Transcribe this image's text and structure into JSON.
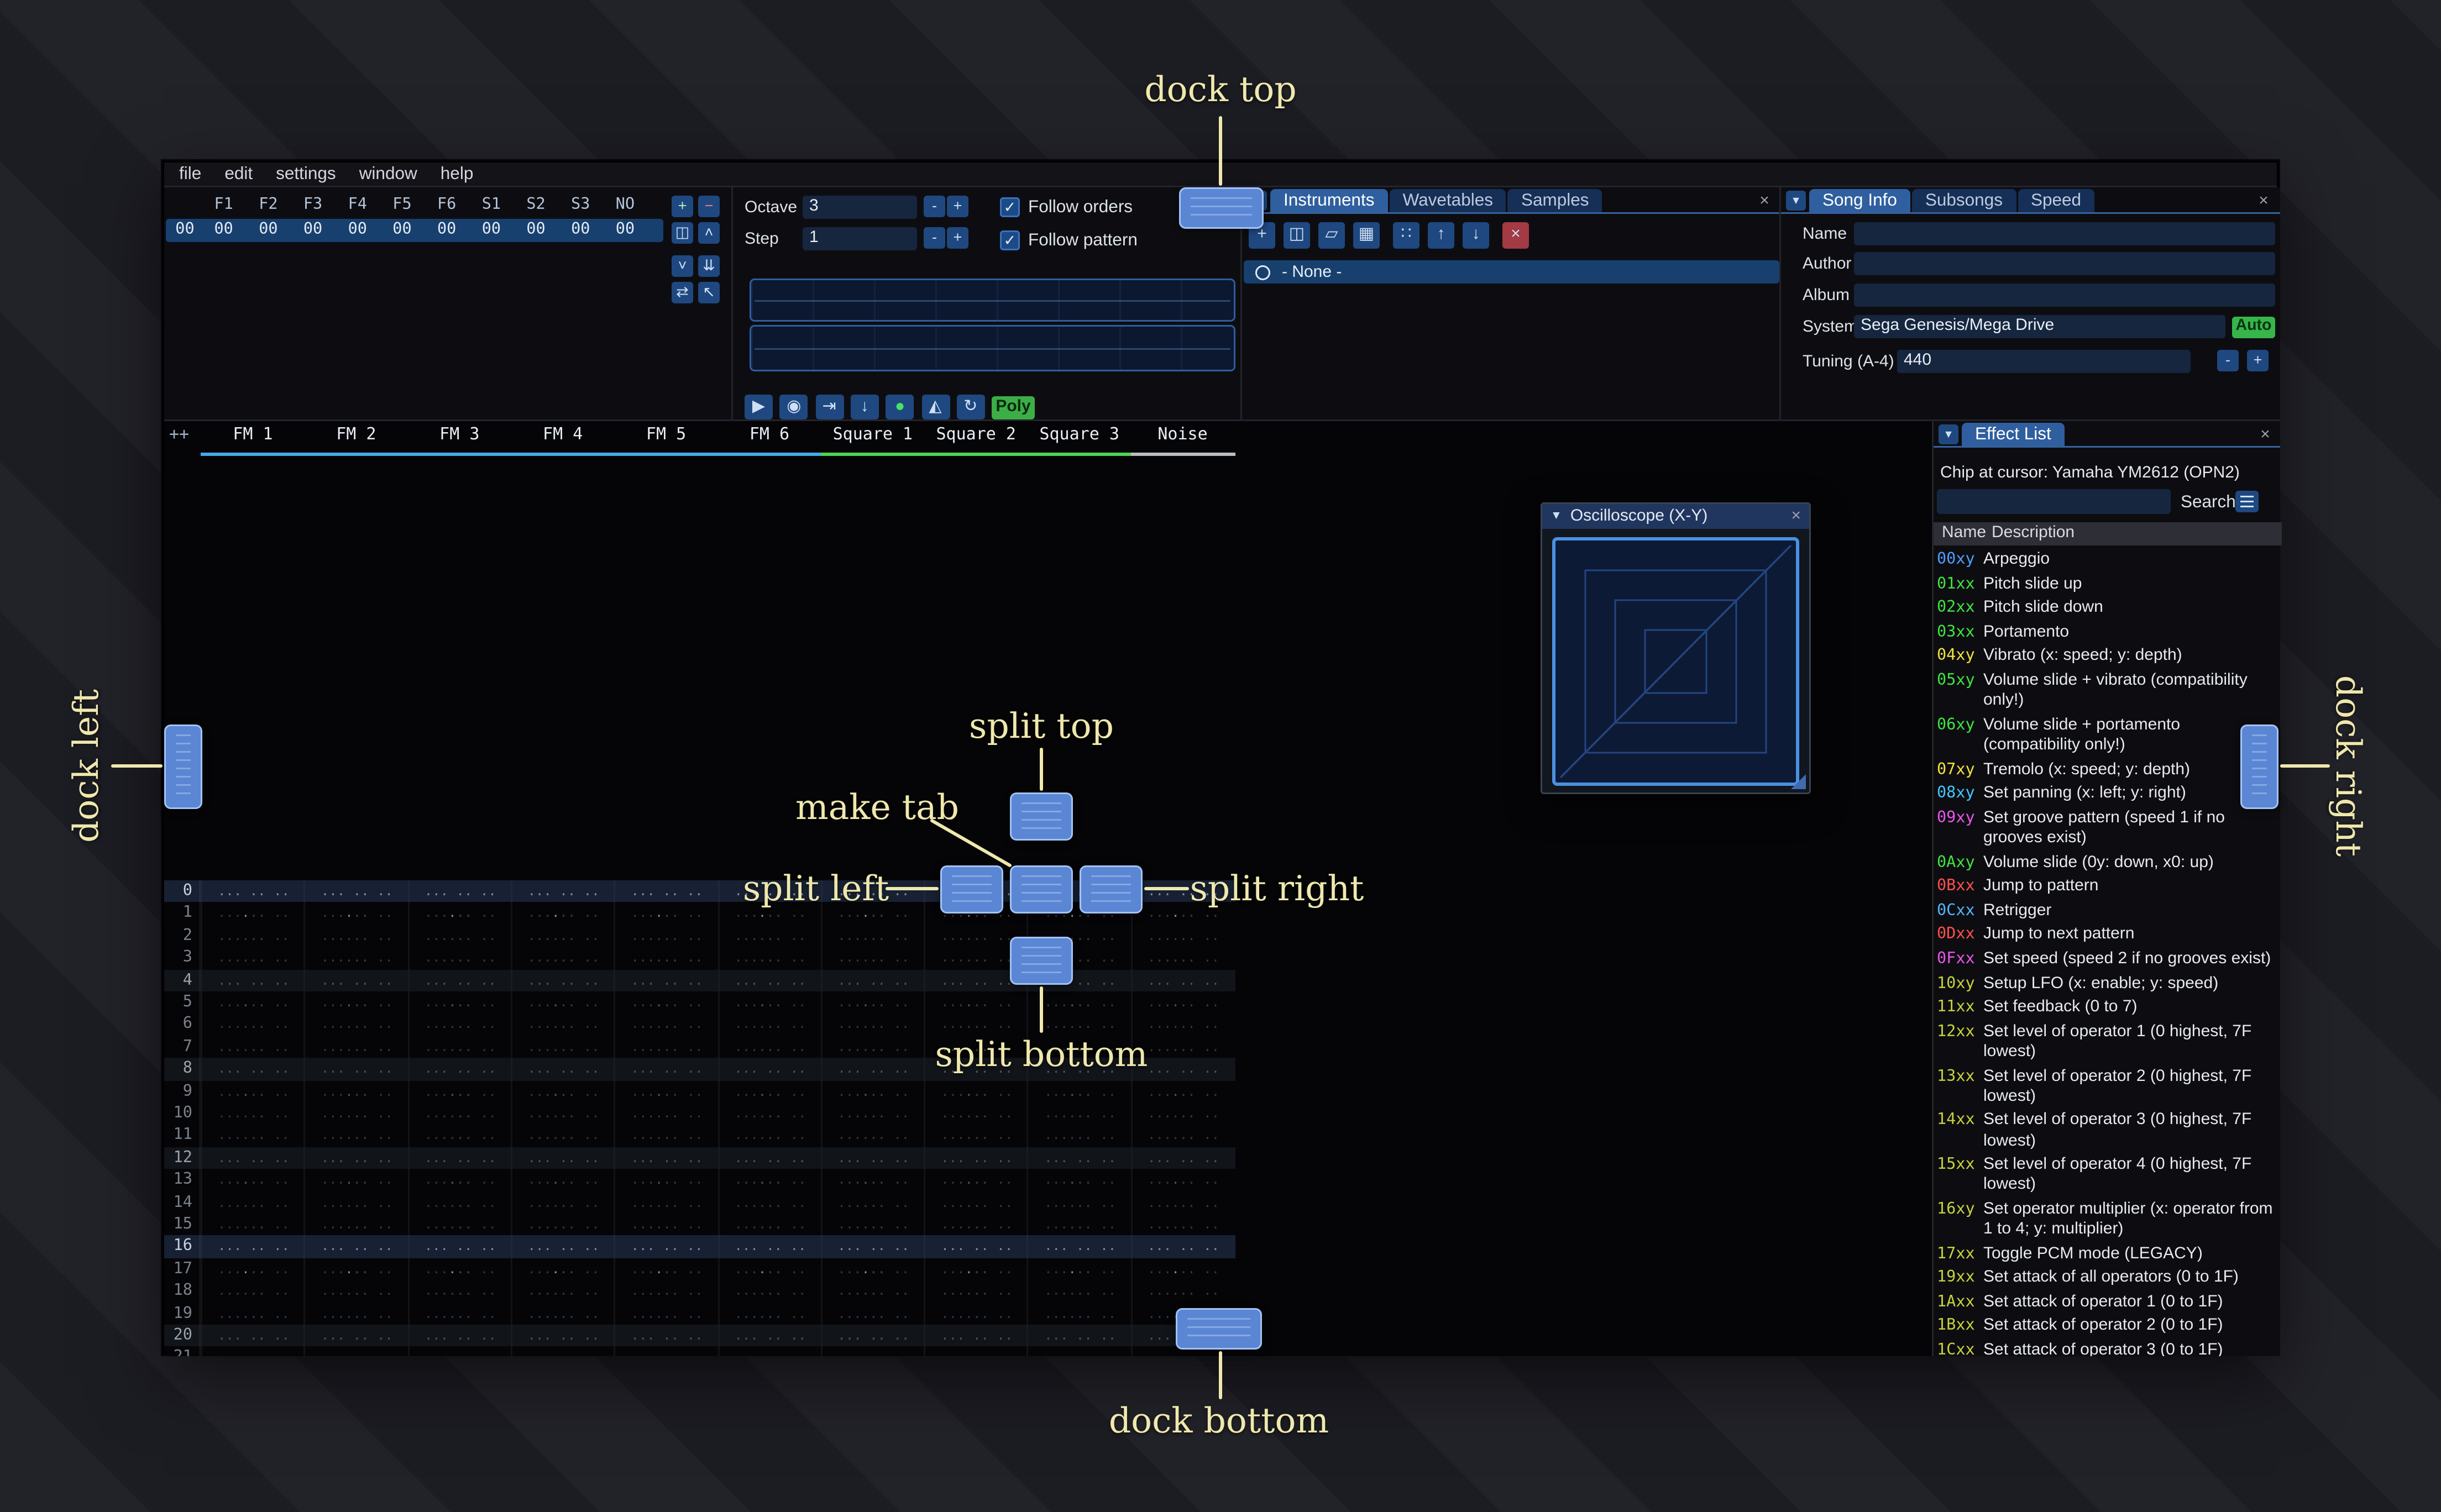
{
  "ui": {
    "minus": "-",
    "plus": "+",
    "check": "✓",
    "collapse": "▼",
    "close": "×"
  },
  "colors": {
    "accent": "#4296fa",
    "selection": "#17406f",
    "dock_overlay": "#5a86d4",
    "annotation": "#efe8ad"
  },
  "menu": {
    "items": [
      "file",
      "edit",
      "settings",
      "window",
      "help"
    ]
  },
  "orders": {
    "channels": [
      "F1",
      "F2",
      "F3",
      "F4",
      "F5",
      "F6",
      "S1",
      "S2",
      "S3",
      "NO"
    ],
    "row": {
      "index": "00",
      "values": [
        "00",
        "00",
        "00",
        "00",
        "00",
        "00",
        "00",
        "00",
        "00",
        "00"
      ]
    },
    "buttons": [
      {
        "name": "add",
        "glyph": "+",
        "color": "#b9f0c0"
      },
      {
        "name": "remove",
        "glyph": "−",
        "color": "#ff7a7a"
      },
      {
        "name": "duplicate",
        "glyph": "◫"
      },
      {
        "name": "move-up",
        "glyph": "˄"
      },
      {
        "name": "move-down",
        "glyph": "˅"
      },
      {
        "name": "duplicate-to-end",
        "glyph": "⇊"
      },
      {
        "name": "change-all",
        "glyph": "⇄"
      },
      {
        "name": "edit-mode",
        "glyph": "↖"
      }
    ]
  },
  "play_controls": {
    "octave_label": "Octave",
    "octave_value": "3",
    "step_label": "Step",
    "step_value": "1",
    "follow_orders": "Follow orders",
    "follow_pattern": "Follow pattern",
    "poly_label": "Poly",
    "transport": [
      {
        "name": "play",
        "glyph": "▶"
      },
      {
        "name": "play-pattern",
        "glyph": "◉"
      },
      {
        "name": "play-from-cursor",
        "glyph": "⇥"
      },
      {
        "name": "step-one-row",
        "glyph": "↓"
      },
      {
        "name": "edit-record",
        "glyph": "●",
        "color": "#42e663"
      },
      {
        "name": "metronome",
        "glyph": "◭"
      },
      {
        "name": "repeat-pattern",
        "glyph": "↻"
      }
    ]
  },
  "instruments": {
    "tabs": [
      "Instruments",
      "Wavetables",
      "Samples"
    ],
    "active_tab": "Instruments",
    "toolbar": [
      {
        "name": "add-instrument",
        "glyph": "+"
      },
      {
        "name": "duplicate-instrument",
        "glyph": "◫"
      },
      {
        "name": "open-instrument",
        "glyph": "▱"
      },
      {
        "name": "save-instrument",
        "glyph": "▦"
      },
      {
        "name": "instrument-folders",
        "glyph": "∷"
      },
      {
        "name": "move-instrument-up",
        "glyph": "↑"
      },
      {
        "name": "move-instrument-down",
        "glyph": "↓"
      },
      {
        "name": "delete-instrument",
        "glyph": "×",
        "bg": "#a33a44"
      }
    ],
    "list": [
      {
        "label": "- None -",
        "selected": true
      }
    ]
  },
  "song_info": {
    "tabs": [
      "Song Info",
      "Subsongs",
      "Speed"
    ],
    "active_tab": "Song Info",
    "name_label": "Name",
    "name_value": "",
    "author_label": "Author",
    "author_value": "",
    "album_label": "Album",
    "album_value": "",
    "system_label": "System",
    "system_value": "Sega Genesis/Mega Drive",
    "auto_label": "Auto",
    "tuning_label": "Tuning (A-4)",
    "tuning_value": "440"
  },
  "pattern": {
    "corner_label": "++",
    "channels": [
      {
        "name": "FM 1",
        "color": "#45aae8"
      },
      {
        "name": "FM 2",
        "color": "#45aae8"
      },
      {
        "name": "FM 3",
        "color": "#45aae8"
      },
      {
        "name": "FM 4",
        "color": "#45aae8"
      },
      {
        "name": "FM 5",
        "color": "#45aae8"
      },
      {
        "name": "FM 6",
        "color": "#45aae8"
      },
      {
        "name": "Square 1",
        "color": "#4fd44f"
      },
      {
        "name": "Square 2",
        "color": "#4fd44f"
      },
      {
        "name": "Square 3",
        "color": "#4fd44f"
      },
      {
        "name": "Noise",
        "color": "#b8bdc4"
      }
    ],
    "rows": {
      "start": 0,
      "count": 22
    },
    "empty_cell": "... .. .. ..."
  },
  "oscilloscope": {
    "title": "Oscilloscope (X-Y)"
  },
  "effect_list": {
    "tab": "Effect List",
    "chip_line": "Chip at cursor: Yamaha YM2612 (OPN2)",
    "search_label": "Search",
    "search_value": "",
    "columns": [
      "Name",
      "Description"
    ],
    "effects": [
      {
        "name": "00xy",
        "color": "#4d9fff",
        "desc": "Arpeggio"
      },
      {
        "name": "01xx",
        "color": "#3fe43f",
        "desc": "Pitch slide up"
      },
      {
        "name": "02xx",
        "color": "#3fe43f",
        "desc": "Pitch slide down"
      },
      {
        "name": "03xx",
        "color": "#3fe43f",
        "desc": "Portamento"
      },
      {
        "name": "04xy",
        "color": "#f2e33c",
        "desc": "Vibrato (x: speed; y: depth)"
      },
      {
        "name": "05xy",
        "color": "#3fe43f",
        "desc": "Volume slide + vibrato (compatibility only!)"
      },
      {
        "name": "06xy",
        "color": "#3fe43f",
        "desc": "Volume slide + portamento (compatibility only!)"
      },
      {
        "name": "07xy",
        "color": "#f2e33c",
        "desc": "Tremolo (x: speed; y: depth)"
      },
      {
        "name": "08xy",
        "color": "#42c6ff",
        "desc": "Set panning (x: left; y: right)"
      },
      {
        "name": "09xy",
        "color": "#e956e9",
        "desc": "Set groove pattern (speed 1 if no grooves exist)"
      },
      {
        "name": "0Axy",
        "color": "#3fe43f",
        "desc": "Volume slide (0y: down, x0: up)"
      },
      {
        "name": "0Bxx",
        "color": "#ff4f4f",
        "desc": "Jump to pattern"
      },
      {
        "name": "0Cxx",
        "color": "#52b6ff",
        "desc": "Retrigger"
      },
      {
        "name": "0Dxx",
        "color": "#ff4f4f",
        "desc": "Jump to next pattern"
      },
      {
        "name": "0Fxx",
        "color": "#e956e9",
        "desc": "Set speed (speed 2 if no grooves exist)"
      },
      {
        "name": "10xy",
        "color": "#c8d23d",
        "desc": "Setup LFO (x: enable; y: speed)"
      },
      {
        "name": "11xx",
        "color": "#c8d23d",
        "desc": "Set feedback (0 to 7)"
      },
      {
        "name": "12xx",
        "color": "#c8d23d",
        "desc": "Set level of operator 1 (0 highest, 7F lowest)"
      },
      {
        "name": "13xx",
        "color": "#c8d23d",
        "desc": "Set level of operator 2 (0 highest, 7F lowest)"
      },
      {
        "name": "14xx",
        "color": "#c8d23d",
        "desc": "Set level of operator 3 (0 highest, 7F lowest)"
      },
      {
        "name": "15xx",
        "color": "#c8d23d",
        "desc": "Set level of operator 4 (0 highest, 7F lowest)"
      },
      {
        "name": "16xy",
        "color": "#c8d23d",
        "desc": "Set operator multiplier (x: operator from 1 to 4; y: multiplier)"
      },
      {
        "name": "17xx",
        "color": "#c8d23d",
        "desc": "Toggle PCM mode (LEGACY)"
      },
      {
        "name": "19xx",
        "color": "#c8d23d",
        "desc": "Set attack of all operators (0 to 1F)"
      },
      {
        "name": "1Axx",
        "color": "#c8d23d",
        "desc": "Set attack of operator 1 (0 to 1F)"
      },
      {
        "name": "1Bxx",
        "color": "#c8d23d",
        "desc": "Set attack of operator 2 (0 to 1F)"
      },
      {
        "name": "1Cxx",
        "color": "#c8d23d",
        "desc": "Set attack of operator 3 (0 to 1F)"
      }
    ]
  },
  "annotations": {
    "dock_top": "dock top",
    "dock_bottom": "dock bottom",
    "dock_left": "dock left",
    "dock_right": "dock right",
    "split_top": "split top",
    "split_bottom": "split bottom",
    "split_left": "split left",
    "split_right": "split right",
    "make_tab": "make tab"
  }
}
